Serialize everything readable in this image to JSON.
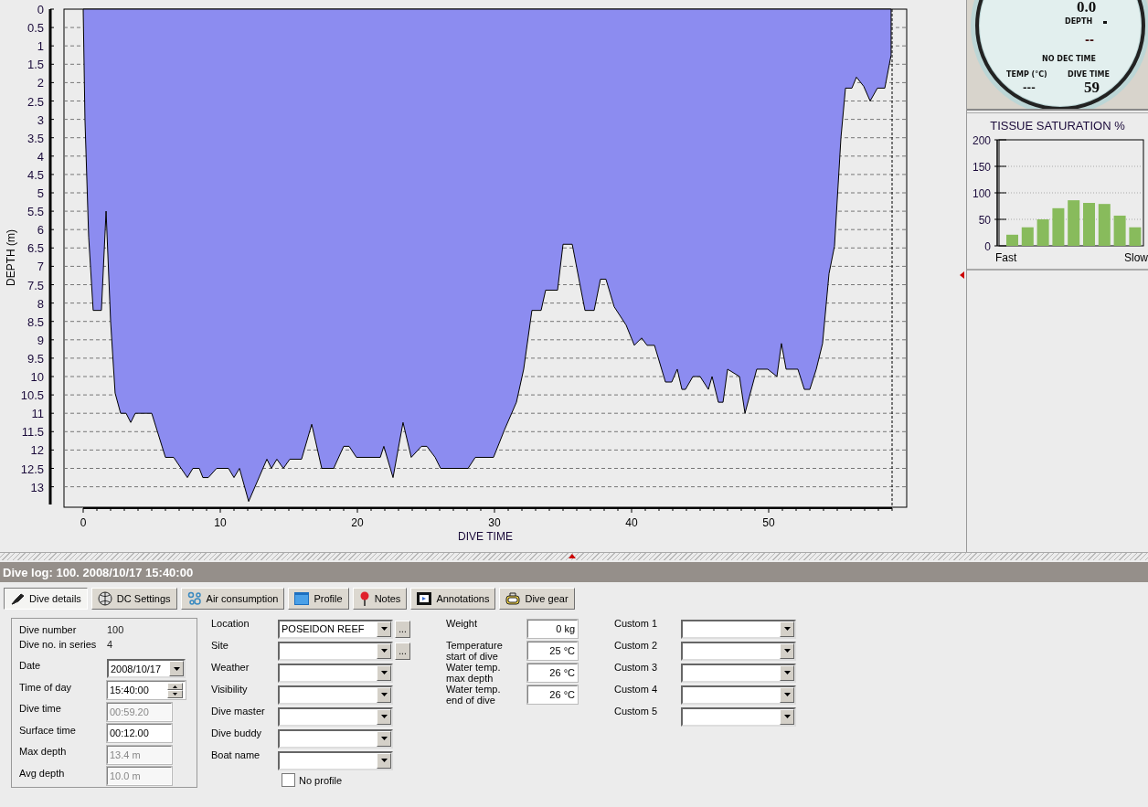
{
  "depth_chart": {
    "chart_data": {
      "type": "area",
      "grid": true,
      "xlabel": "DIVE TIME",
      "ylabel": "DEPTH (m)",
      "xlim": [
        0,
        59
      ],
      "ylim": [
        13.5,
        0
      ],
      "xticks": [
        0,
        10,
        20,
        30,
        40,
        50
      ],
      "yticks": [
        0,
        0.5,
        1,
        1.5,
        2,
        2.5,
        3,
        3.5,
        4,
        4.5,
        5,
        5.5,
        6,
        6.5,
        7,
        7.5,
        8,
        8.5,
        9,
        9.5,
        10,
        10.5,
        11,
        11.5,
        12,
        12.5,
        13
      ],
      "x": [
        0,
        0.13,
        0.4,
        0.73,
        1.33,
        1.67,
        2,
        2.33,
        2.73,
        3.13,
        3.47,
        3.8,
        5,
        6,
        6.6,
        7.6,
        8,
        8.47,
        8.73,
        9.13,
        9.73,
        10.6,
        11,
        11.4,
        12.07,
        13.4,
        13.73,
        14.13,
        14.6,
        15.07,
        15.93,
        16.67,
        17.4,
        18.27,
        19,
        19.4,
        19.93,
        21.67,
        21.93,
        22.6,
        23.33,
        23.93,
        24.67,
        25.07,
        25.67,
        26.07,
        28.07,
        28.6,
        29.93,
        30.73,
        31.6,
        32.13,
        32.73,
        33.4,
        33.73,
        34.6,
        35,
        35.67,
        36.6,
        37.27,
        37.73,
        38.13,
        38.73,
        39.6,
        40.2,
        40.73,
        41.13,
        41.67,
        42.47,
        42.93,
        43.33,
        43.67,
        43.93,
        44.47,
        45,
        45.6,
        45.87,
        46.33,
        46.67,
        47,
        47.87,
        48.27,
        49.13,
        49.93,
        50.6,
        50.93,
        51.27,
        52.13,
        52.6,
        53,
        53.47,
        53.93,
        54.4,
        54.8,
        55.27,
        55.6,
        56.07,
        56.4,
        56.93,
        57.4,
        57.93,
        58.47,
        58.93,
        58.93
      ],
      "series": [
        {
          "color": "#8c8cf0",
          "values": [
            0,
            3,
            6.2,
            8.2,
            8.2,
            5.5,
            8.5,
            10.45,
            11,
            11,
            11.25,
            11,
            11,
            12.2,
            12.2,
            12.75,
            12.5,
            12.5,
            12.75,
            12.75,
            12.5,
            12.5,
            12.75,
            12.5,
            13.4,
            12.25,
            12.5,
            12.25,
            12.5,
            12.25,
            12.25,
            11.3,
            12.5,
            12.5,
            11.9,
            11.9,
            12.2,
            12.2,
            11.9,
            12.75,
            11.25,
            12.2,
            11.9,
            11.9,
            12.2,
            12.5,
            12.5,
            12.2,
            12.2,
            11.45,
            10.7,
            9.8,
            8.2,
            8.2,
            7.65,
            7.65,
            6.4,
            6.4,
            8.2,
            8.2,
            7.35,
            7.35,
            8.1,
            8.6,
            9.15,
            8.95,
            9.15,
            9.15,
            10.15,
            10.15,
            9.8,
            10.35,
            10.35,
            10,
            10,
            10.35,
            10,
            10.7,
            10.7,
            9.8,
            10,
            11,
            9.8,
            9.8,
            10,
            9.1,
            9.8,
            9.8,
            10.35,
            10.35,
            9.8,
            9.1,
            7.2,
            6.45,
            3.5,
            2.15,
            2.15,
            1.85,
            2.1,
            2.5,
            2.15,
            2.15,
            1.25,
            0
          ]
        }
      ]
    }
  },
  "gauge": {
    "depth": "0.0",
    "depth_label": "DEPTH",
    "deco": "--",
    "deco_label": "NO DEC TIME",
    "temp_label": "TEMP (°C)",
    "temp": "---",
    "time_label": "DIVE TIME",
    "time": "59"
  },
  "tissue": {
    "chart_data": {
      "type": "bar",
      "title": "TISSUE SATURATION %",
      "grid": true,
      "ylim": [
        0,
        200
      ],
      "yticks": [
        0,
        50,
        100,
        150,
        200
      ],
      "values": [
        21,
        35,
        50,
        71,
        86,
        81,
        79,
        57,
        35
      ],
      "color": "#88bb5c",
      "annotations": [
        "Fast",
        "Slow"
      ]
    }
  },
  "log_title": "Dive log: 100. 2008/10/17 15:40:00",
  "tabs": [
    {
      "label": "Dive details",
      "selected": true
    },
    {
      "label": "DC Settings",
      "selected": false
    },
    {
      "label": "Air consumption",
      "selected": false
    },
    {
      "label": "Profile",
      "selected": false
    },
    {
      "label": "Notes",
      "selected": false
    },
    {
      "label": "Annotations",
      "selected": false
    },
    {
      "label": "Dive gear",
      "selected": false
    }
  ],
  "details": [
    {
      "kind": "static",
      "label": "Dive number",
      "value": "100"
    },
    {
      "kind": "static",
      "label": "Dive no. in series",
      "value": "4"
    },
    {
      "kind": "date",
      "label": "Date",
      "value": "2008/10/17",
      "disabled": false
    },
    {
      "kind": "spin",
      "label": "Time of day",
      "value": "15:40:00",
      "disabled": false
    },
    {
      "kind": "text",
      "label": "Dive time",
      "value": "00:59.20",
      "disabled": true
    },
    {
      "kind": "text",
      "label": "Surface time",
      "value": "00:12.00",
      "disabled": false
    },
    {
      "kind": "text",
      "label": "Max depth",
      "value": "13.4 m",
      "disabled": true
    },
    {
      "kind": "text",
      "label": "Avg depth",
      "value": "10.0 m",
      "disabled": true
    }
  ],
  "place_fields": [
    {
      "label": "Location",
      "value": "POSEIDON REEF",
      "browse": "..."
    },
    {
      "label": "Site",
      "browse": "..."
    },
    {
      "label": "Weather"
    },
    {
      "label": "Visibility"
    },
    {
      "label": "Dive master"
    },
    {
      "label": "Dive buddy"
    },
    {
      "label": "Boat name"
    }
  ],
  "no_profile": {
    "label": "No profile",
    "checked": false
  },
  "measure_fields": [
    {
      "label": "Weight",
      "value": "0 kg"
    },
    {
      "label": "Temperature start of dive",
      "value": "25 °C"
    },
    {
      "label": "Water temp. max depth",
      "value": "26 °C"
    },
    {
      "label": "Water temp. end of dive",
      "value": "26 °C"
    }
  ],
  "custom_fields": [
    {
      "label": "Custom 1"
    },
    {
      "label": "Custom 2"
    },
    {
      "label": "Custom 3"
    },
    {
      "label": "Custom 4"
    },
    {
      "label": "Custom 5"
    }
  ]
}
